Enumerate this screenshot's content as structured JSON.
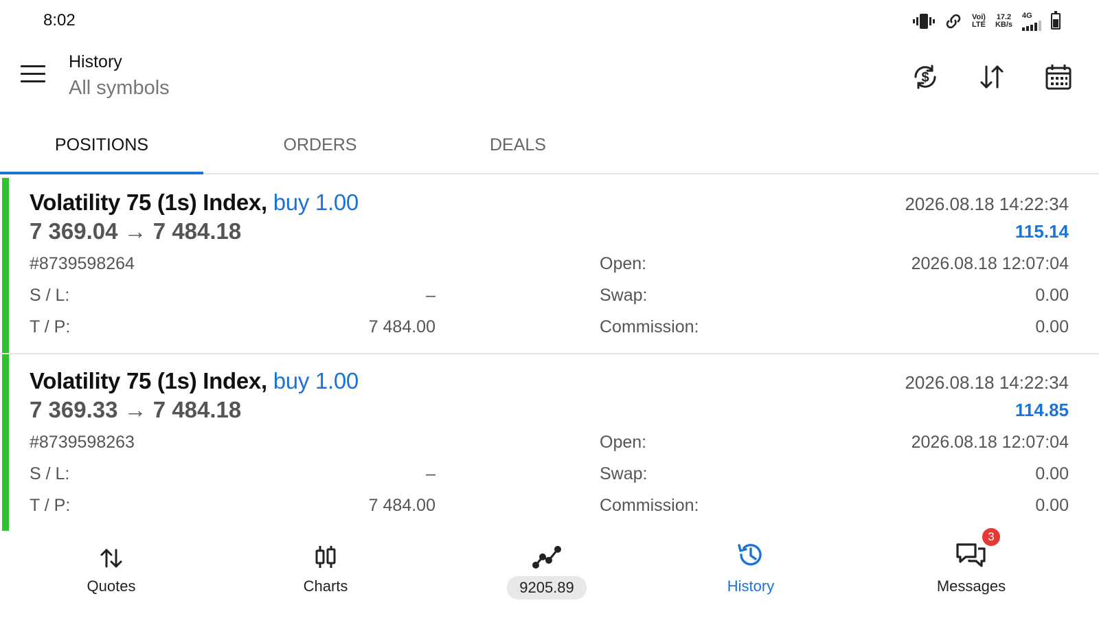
{
  "status_bar": {
    "time": "8:02",
    "volte_line1": "Voi)",
    "volte_line2": "LTE",
    "speed_value": "17.2",
    "speed_unit": "KB/s",
    "network": "4G"
  },
  "header": {
    "title": "History",
    "subtitle": "All symbols",
    "actions": [
      "currency-refresh-icon",
      "sort-icon",
      "calendar-icon"
    ]
  },
  "tabs": [
    {
      "label": "POSITIONS",
      "active": true
    },
    {
      "label": "ORDERS",
      "active": false
    },
    {
      "label": "DEALS",
      "active": false
    }
  ],
  "positions": [
    {
      "symbol": "Volatility 75 (1s) Index,",
      "side": "buy 1.00",
      "prices": "7 369.04 → 7 484.18",
      "close_time": "2026.08.18 14:22:34",
      "profit": "115.14",
      "ticket": "#8739598264",
      "sl_label": "S / L:",
      "sl_value": "–",
      "tp_label": "T / P:",
      "tp_value": "7 484.00",
      "open_label": "Open:",
      "open_value": "2026.08.18 12:07:04",
      "swap_label": "Swap:",
      "swap_value": "0.00",
      "commission_label": "Commission:",
      "commission_value": "0.00"
    },
    {
      "symbol": "Volatility 75 (1s) Index,",
      "side": "buy 1.00",
      "prices": "7 369.33 → 7 484.18",
      "close_time": "2026.08.18 14:22:34",
      "profit": "114.85",
      "ticket": "#8739598263",
      "sl_label": "S / L:",
      "sl_value": "–",
      "tp_label": "T / P:",
      "tp_value": "7 484.00",
      "open_label": "Open:",
      "open_value": "2026.08.18 12:07:04",
      "swap_label": "Swap:",
      "swap_value": "0.00",
      "commission_label": "Commission:",
      "commission_value": "0.00"
    }
  ],
  "bottom_nav": {
    "quotes": "Quotes",
    "charts": "Charts",
    "balance": "9205.89",
    "history": "History",
    "messages": "Messages",
    "messages_badge": "3"
  },
  "colors": {
    "accent": "#1a73d9",
    "position_bar": "#2ec22e",
    "badge": "#e53935"
  }
}
